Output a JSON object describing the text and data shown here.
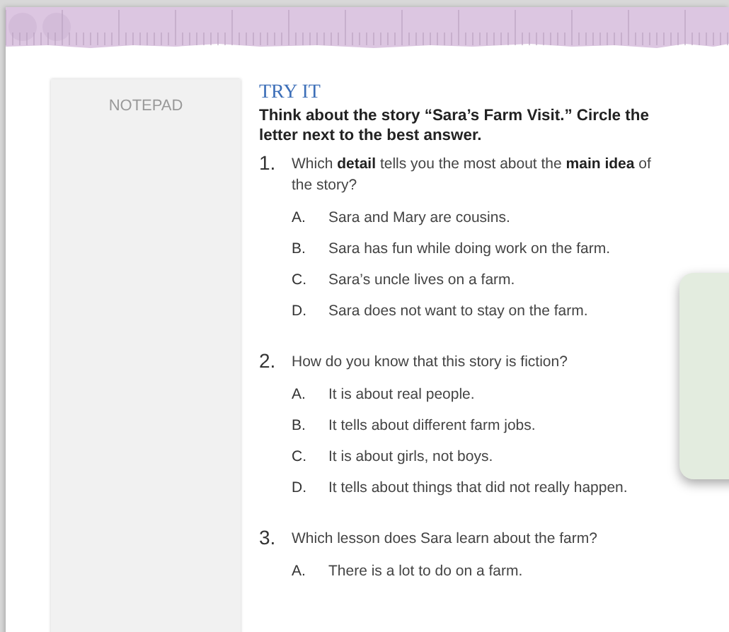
{
  "notepad": {
    "label": "NOTEPAD"
  },
  "heading": "TRY IT",
  "instructions": "Think about the story “Sara’s Farm Visit.” Circle the letter next to the best answer.",
  "questions": [
    {
      "number": "1.",
      "text": "Which **detail** tells you the most about the **main idea** of the story?",
      "options": [
        {
          "letter": "A.",
          "text": "Sara and Mary are cousins."
        },
        {
          "letter": "B.",
          "text": "Sara has fun while doing work on the farm."
        },
        {
          "letter": "C.",
          "text": "Sara’s uncle lives on a farm."
        },
        {
          "letter": "D.",
          "text": "Sara does not want to stay on the farm."
        }
      ]
    },
    {
      "number": "2.",
      "text": "How do you know that this story is fiction?",
      "options": [
        {
          "letter": "A.",
          "text": "It is about real people."
        },
        {
          "letter": "B.",
          "text": "It tells about different farm jobs."
        },
        {
          "letter": "C.",
          "text": "It is about girls, not boys."
        },
        {
          "letter": "D.",
          "text": "It tells about things that did not really happen."
        }
      ]
    },
    {
      "number": "3.",
      "text": "Which lesson does Sara learn about the farm?",
      "options": [
        {
          "letter": "A.",
          "text": "There is a lot to do on a farm."
        }
      ]
    }
  ]
}
